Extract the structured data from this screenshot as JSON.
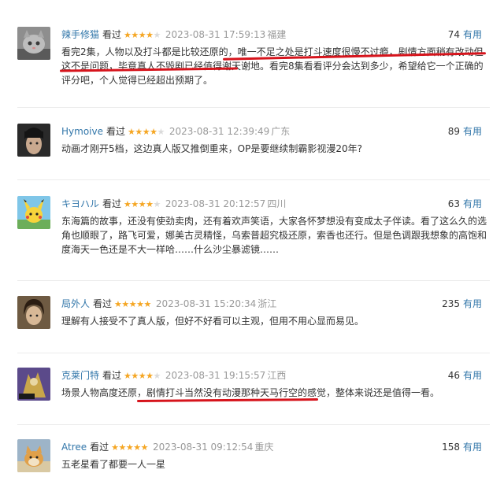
{
  "reviews": [
    {
      "user": "辣手修猫",
      "watched": "看过",
      "rating": 4,
      "time": "2023-08-31 17:59:13",
      "location": "福建",
      "votes": "74",
      "useful": "有用",
      "content": "看完2集，人物以及打斗都是比较还原的，唯一不足之处是打斗速度很慢不过瘾，剧情方面稍有改动但这不是问题，毕竟真人不毁剧已经值得谢天谢地。看完8集看看评分会达到多少，希望给它一个正确的评分吧，个人觉得已经超出预期了。"
    },
    {
      "user": "Hymoive",
      "watched": "看过",
      "rating": 4,
      "time": "2023-08-31 12:39:49",
      "location": "广东",
      "votes": "89",
      "useful": "有用",
      "content": "动画才刚开5档，这边真人版又推倒重来，OP是要继续制霸影视漫20年?"
    },
    {
      "user": "キヨハル",
      "watched": "看过",
      "rating": 4,
      "time": "2023-08-31 20:12:57",
      "location": "四川",
      "votes": "63",
      "useful": "有用",
      "content": "东海篇的故事，还没有使劲卖肉，还有着欢声笑语，大家各怀梦想没有变成太子伴读。看了这么久的选角也顺眼了，路飞可爱，娜美古灵精怪，乌索普超究极还原，索香也还行。但是色调跟我想象的高饱和度海天一色还是不大一样哈……什么沙尘暴滤镜……"
    },
    {
      "user": "局外人",
      "watched": "看过",
      "rating": 5,
      "time": "2023-08-31 15:20:34",
      "location": "浙江",
      "votes": "235",
      "useful": "有用",
      "content": "理解有人接受不了真人版，但好不好看可以主观，但用不用心显而易见。"
    },
    {
      "user": "克莱门特",
      "watched": "看过",
      "rating": 4,
      "time": "2023-08-31 19:15:57",
      "location": "江西",
      "votes": "46",
      "useful": "有用",
      "content": "场景人物高度还原，剧情打斗当然没有动漫那种天马行空的感觉，整体来说还是值得一看。"
    },
    {
      "user": "Atree",
      "watched": "看过",
      "rating": 5,
      "time": "2023-08-31 09:12:54",
      "location": "重庆",
      "votes": "158",
      "useful": "有用",
      "content": "五老星看了都要一人一星"
    }
  ],
  "colors": {
    "link": "#3377aa",
    "star": "#f5a623",
    "meta": "#999999",
    "underline": "#d6141c"
  }
}
